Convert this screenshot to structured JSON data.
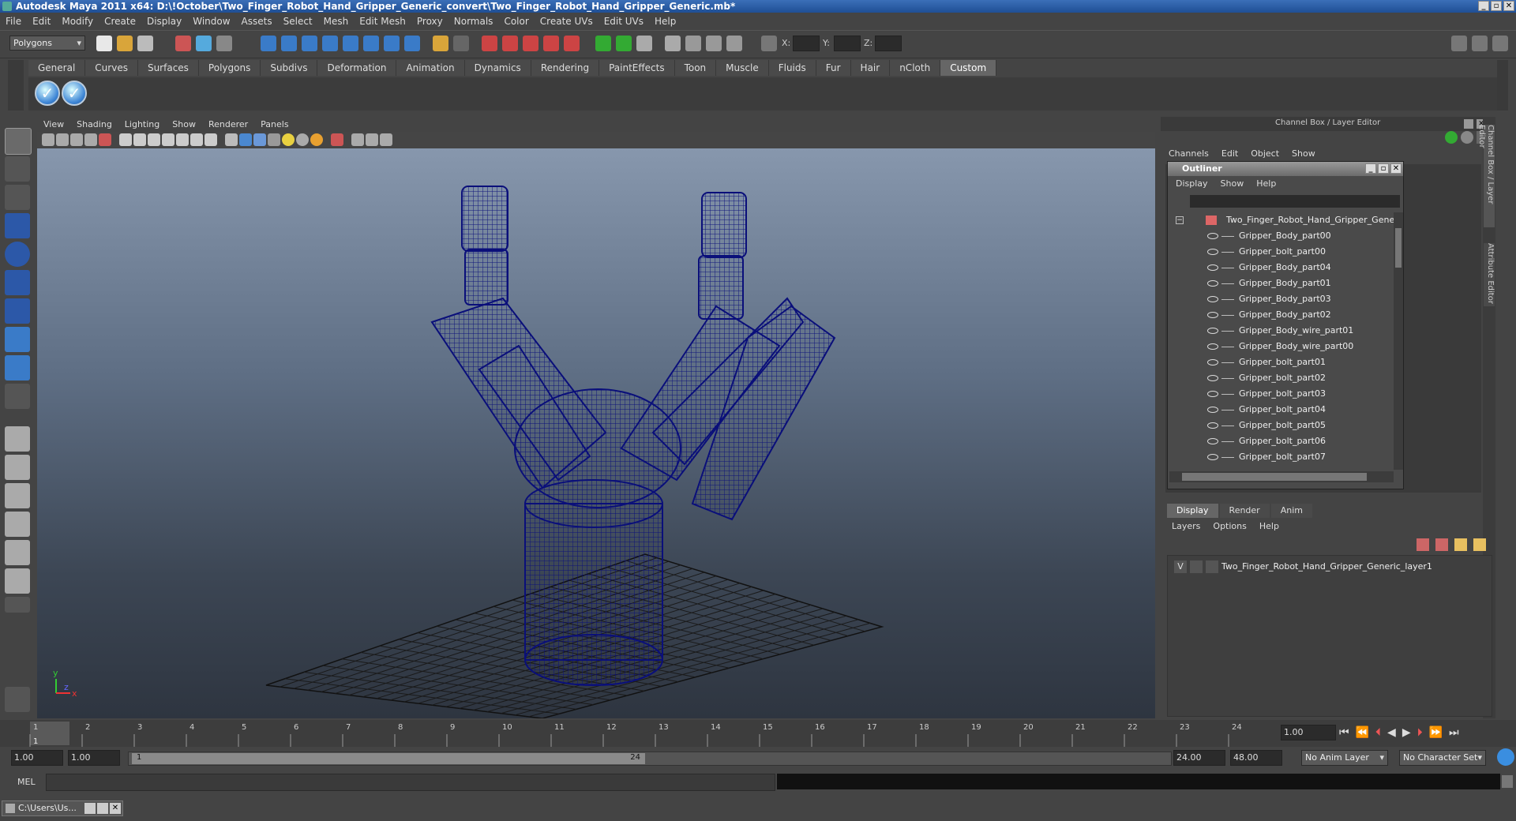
{
  "titlebar": {
    "title": "Autodesk Maya 2011 x64: D:\\!October\\Two_Finger_Robot_Hand_Gripper_Generic_convert\\Two_Finger_Robot_Hand_Gripper_Generic.mb*"
  },
  "menu": [
    "File",
    "Edit",
    "Modify",
    "Create",
    "Display",
    "Window",
    "Assets",
    "Select",
    "Mesh",
    "Edit Mesh",
    "Proxy",
    "Normals",
    "Color",
    "Create UVs",
    "Edit UVs",
    "Help"
  ],
  "statusline": {
    "mode": "Polygons",
    "x_label": "X:",
    "y_label": "Y:",
    "z_label": "Z:"
  },
  "shelf": {
    "tabs": [
      "General",
      "Curves",
      "Surfaces",
      "Polygons",
      "Subdivs",
      "Deformation",
      "Animation",
      "Dynamics",
      "Rendering",
      "PaintEffects",
      "Toon",
      "Muscle",
      "Fluids",
      "Fur",
      "Hair",
      "nCloth",
      "Custom"
    ],
    "active": "Custom"
  },
  "viewport": {
    "menu": [
      "View",
      "Shading",
      "Lighting",
      "Show",
      "Renderer",
      "Panels"
    ],
    "axis_y": "y",
    "axis_x": "x",
    "axis_z": "z"
  },
  "channelbox": {
    "title": "Channel Box / Layer Editor",
    "menu": [
      "Channels",
      "Edit",
      "Object",
      "Show"
    ],
    "side_tabs": [
      "Channel Box / Layer Editor",
      "Attribute Editor"
    ]
  },
  "outliner": {
    "title": "Outliner",
    "menu": [
      "Display",
      "Show",
      "Help"
    ],
    "root": "Two_Finger_Robot_Hand_Gripper_Generic",
    "items": [
      "Gripper_Body_part00",
      "Gripper_bolt_part00",
      "Gripper_Body_part04",
      "Gripper_Body_part01",
      "Gripper_Body_part03",
      "Gripper_Body_part02",
      "Gripper_Body_wire_part01",
      "Gripper_Body_wire_part00",
      "Gripper_bolt_part01",
      "Gripper_bolt_part02",
      "Gripper_bolt_part03",
      "Gripper_bolt_part04",
      "Gripper_bolt_part05",
      "Gripper_bolt_part06",
      "Gripper_bolt_part07"
    ]
  },
  "layereditor": {
    "tabs": [
      "Display",
      "Render",
      "Anim"
    ],
    "active": "Display",
    "menu": [
      "Layers",
      "Options",
      "Help"
    ],
    "layer": {
      "visibility": "V",
      "name": "Two_Finger_Robot_Hand_Gripper_Generic_layer1"
    }
  },
  "timeslider": {
    "ticks": [
      "1",
      "2",
      "3",
      "4",
      "5",
      "6",
      "7",
      "8",
      "9",
      "10",
      "11",
      "12",
      "13",
      "14",
      "15",
      "16",
      "17",
      "18",
      "19",
      "20",
      "21",
      "22",
      "23",
      "24"
    ],
    "current_frame": "1",
    "current_time": "1.00"
  },
  "rangeslider": {
    "start": "1.00",
    "playback_start": "1.00",
    "range_start_label": "1",
    "range_end_label": "24",
    "playback_end": "24.00",
    "end": "48.00",
    "anim_layer": "No Anim Layer",
    "character_set": "No Character Set"
  },
  "cmdline": {
    "label": "MEL"
  },
  "taskbar": {
    "item": "C:\\Users\\Us..."
  },
  "colors": {
    "wireframe": "#0a0f7a",
    "grid": "#111111",
    "accent": "#3b6fb8"
  }
}
